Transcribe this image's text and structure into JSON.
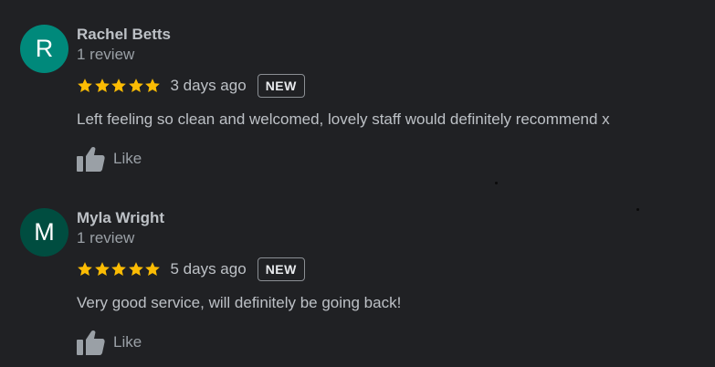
{
  "reviews": [
    {
      "avatar_initial": "R",
      "avatar_color": "#00897b",
      "name": "Rachel Betts",
      "meta": "1 review",
      "rating": 5,
      "date": "3 days ago",
      "badge": "NEW",
      "text": "Left feeling so clean and welcomed, lovely staff would definitely recommend x",
      "like_label": "Like"
    },
    {
      "avatar_initial": "M",
      "avatar_color": "#004d40",
      "name": "Myla Wright",
      "meta": "1 review",
      "rating": 5,
      "date": "5 days ago",
      "badge": "NEW",
      "text": "Very good service, will definitely be going back!",
      "like_label": "Like"
    }
  ],
  "colors": {
    "background": "#202124",
    "star": "#fbbc04",
    "name": "#bdc1c6",
    "secondary_text": "#9aa0a6"
  },
  "icons": {
    "star": "star-icon",
    "like": "thumbs-up-icon"
  }
}
